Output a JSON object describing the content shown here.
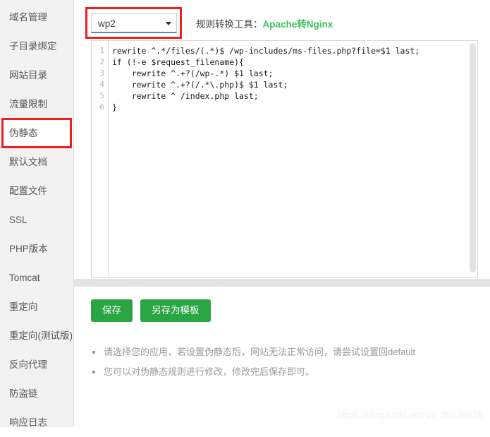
{
  "sidebar": {
    "items": [
      {
        "label": "域名管理",
        "active": false
      },
      {
        "label": "子目录绑定",
        "active": false
      },
      {
        "label": "网站目录",
        "active": false
      },
      {
        "label": "流量限制",
        "active": false
      },
      {
        "label": "伪静态",
        "active": true
      },
      {
        "label": "默认文档",
        "active": false
      },
      {
        "label": "配置文件",
        "active": false
      },
      {
        "label": "SSL",
        "active": false
      },
      {
        "label": "PHP版本",
        "active": false
      },
      {
        "label": "Tomcat",
        "active": false
      },
      {
        "label": "重定向",
        "active": false
      },
      {
        "label": "重定向(测试版)",
        "active": false
      },
      {
        "label": "反向代理",
        "active": false
      },
      {
        "label": "防盗链",
        "active": false
      },
      {
        "label": "响应日志",
        "active": false
      }
    ]
  },
  "toolbar": {
    "select_value": "wp2",
    "select_options": [
      "wp2"
    ],
    "tool_label": "规则转换工具：",
    "tool_link": "Apache转Nginx",
    "link_color": "#3ec05b",
    "annotation_color": "#f01f1f"
  },
  "editor": {
    "line_numbers": [
      "1",
      "2",
      "3",
      "4",
      "5",
      "6"
    ],
    "lines": [
      "rewrite ^.*/files/(.*)$ /wp-includes/ms-files.php?file=$1 last;",
      "if (!-e $request_filename){",
      "    rewrite ^.+?(/wp-.*) $1 last;",
      "    rewrite ^.+?(/.*\\.php)$ $1 last;",
      "    rewrite ^ /index.php last;",
      "}"
    ]
  },
  "buttons": {
    "save": "保存",
    "save_as_template": "另存为模板",
    "color": "#2aa544"
  },
  "tips": [
    "请选择您的应用，若设置伪静态后，网站无法正常访问，请尝试设置回default",
    "您可以对伪静态规则进行修改，修改完后保存即可。"
  ],
  "watermark": "https://blog.csdn.net/qq_35098628"
}
